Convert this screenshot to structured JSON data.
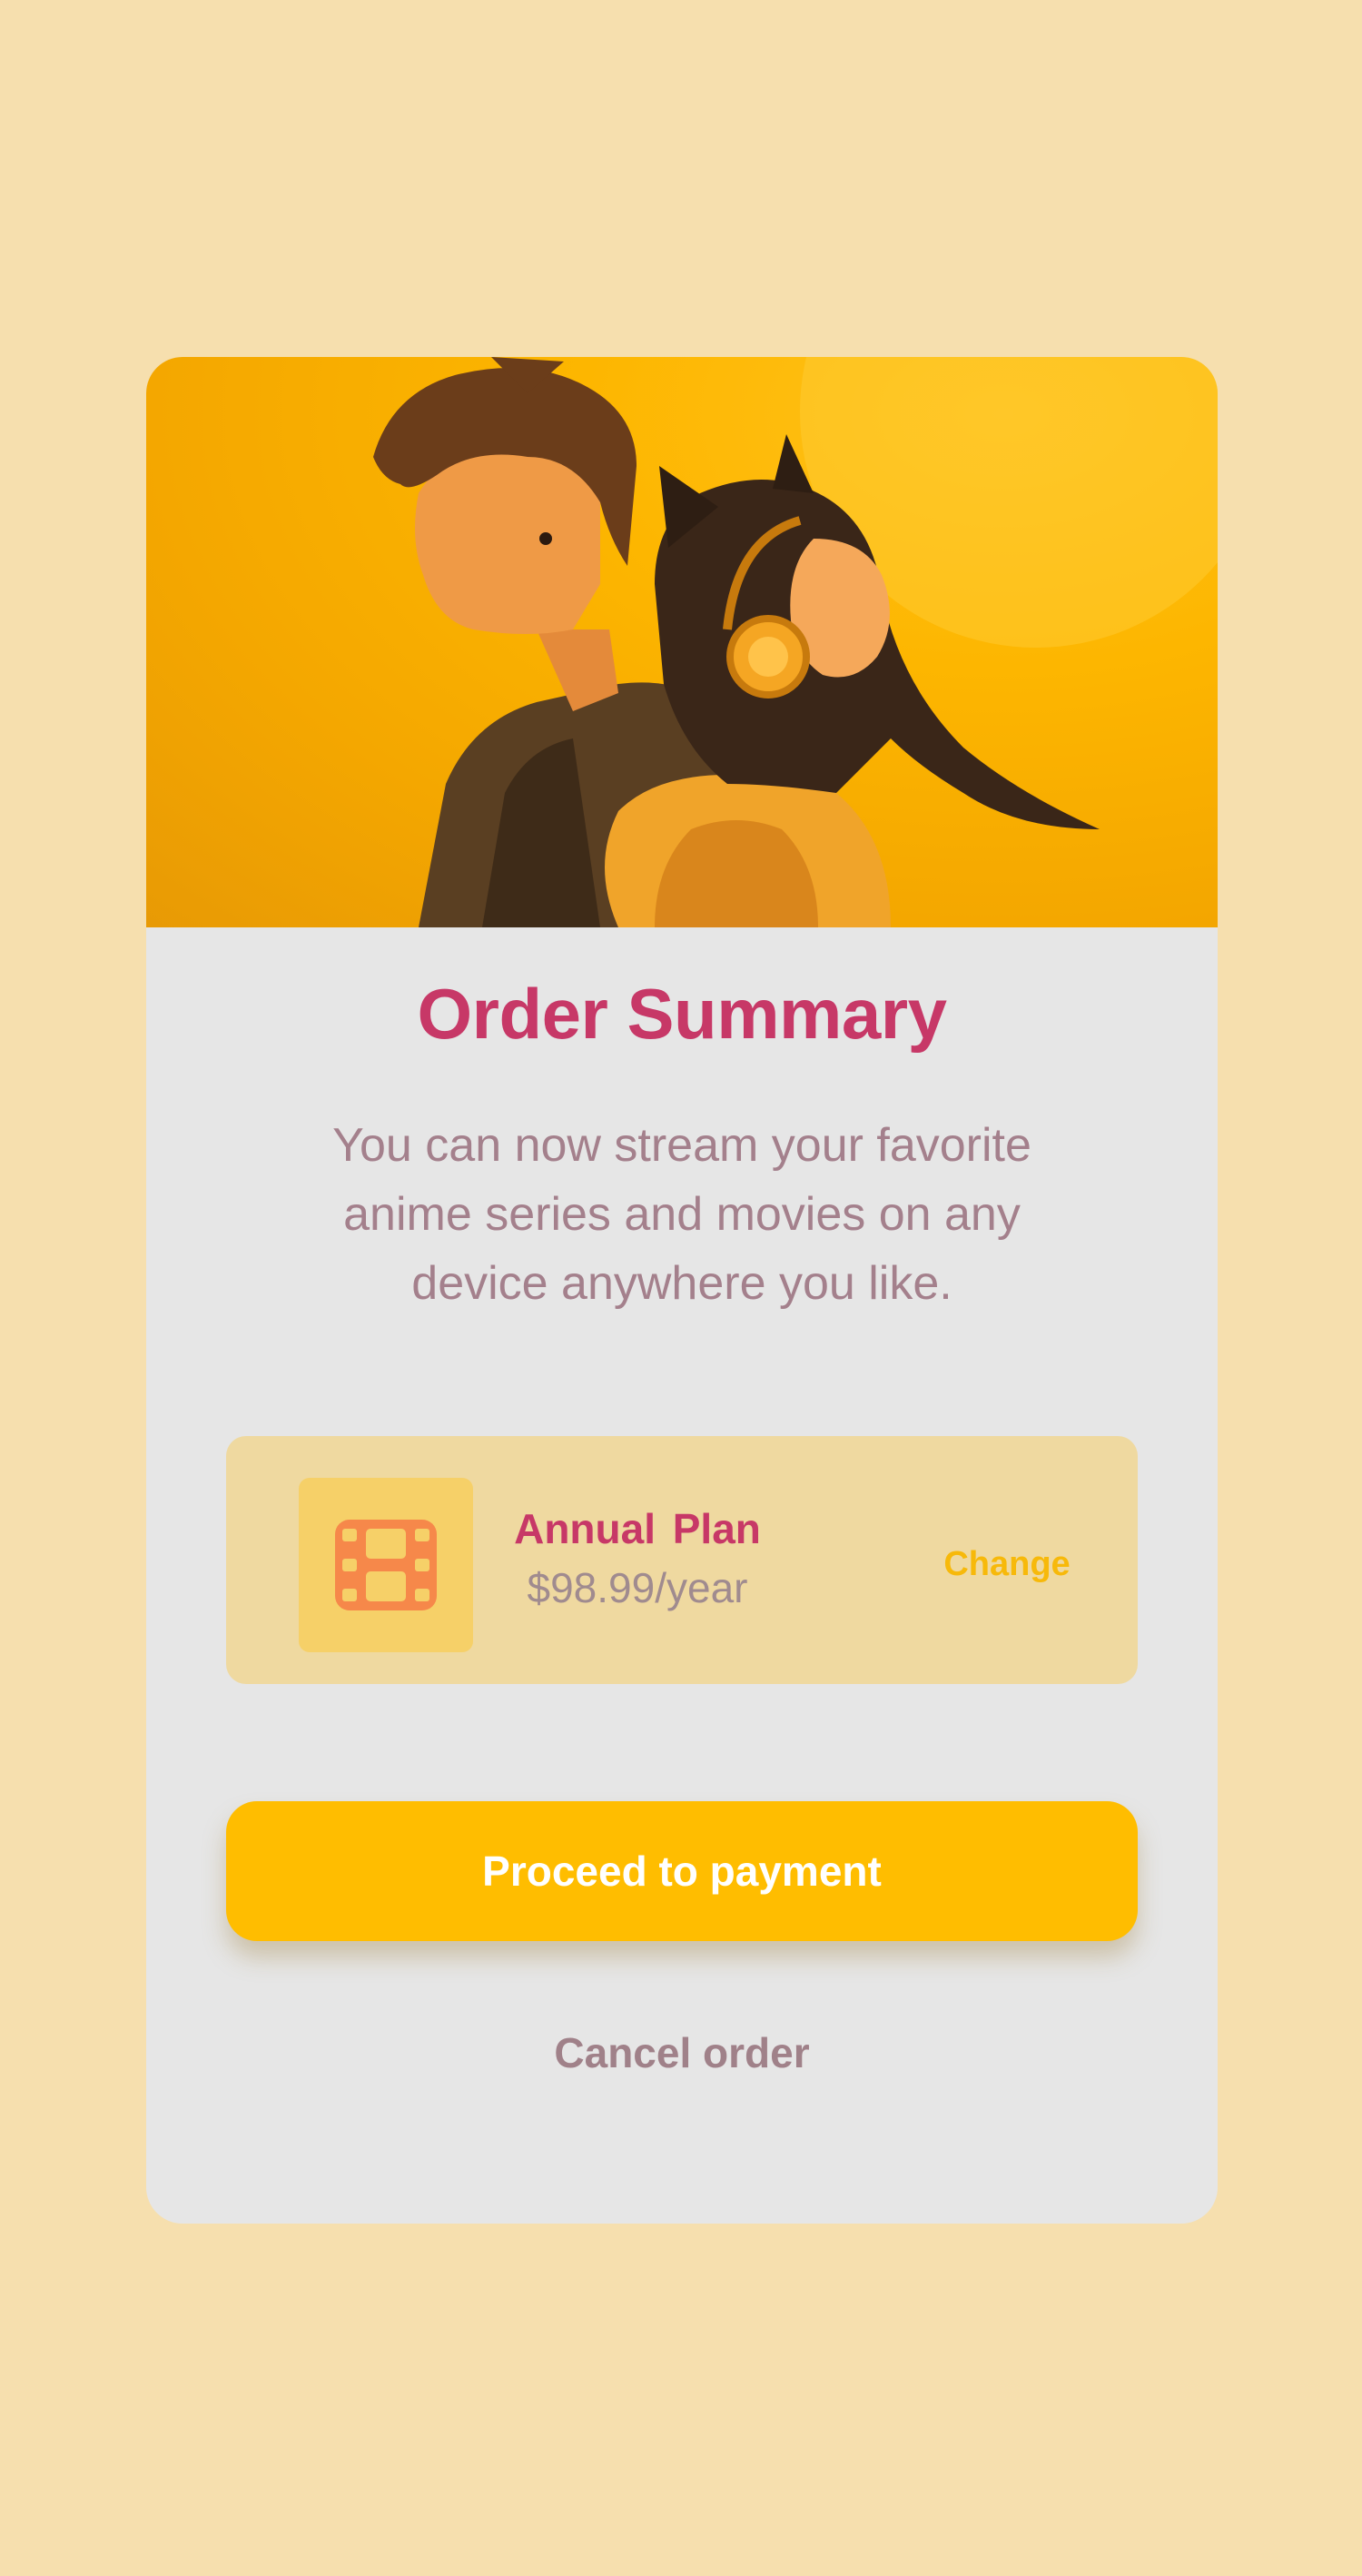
{
  "hero": {
    "image": "anime-couple-illustration",
    "background_color": "#fdb600"
  },
  "order_summary": {
    "title": "Order Summary",
    "description": "You can now stream your favorite anime series and movies  on any device anywhere you like."
  },
  "plan": {
    "icon": "film-icon",
    "name": "Annual Plan",
    "price": "$98.99/year",
    "change_label": "Change"
  },
  "actions": {
    "proceed_label": "Proceed to payment",
    "cancel_label": "Cancel order"
  },
  "colors": {
    "page_background": "#f6dfae",
    "card_background": "#e6e6e6",
    "accent_pink": "#c73867",
    "accent_yellow": "#ffbd00",
    "muted_text": "#a4808c",
    "plan_box": "#efd9a0",
    "icon_tile": "#f6d068",
    "icon_color": "#f6884a"
  }
}
